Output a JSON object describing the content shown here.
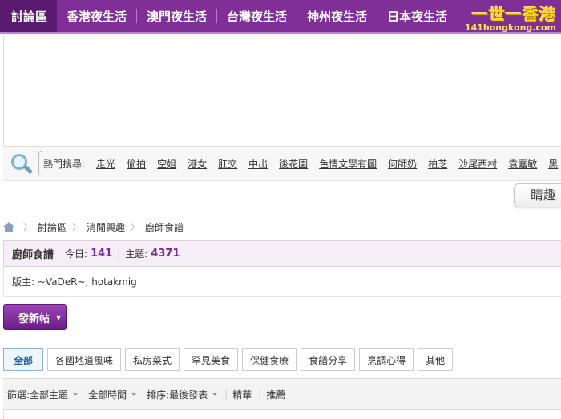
{
  "nav": {
    "items": [
      "討論區",
      "香港夜生活",
      "澳門夜生活",
      "台灣夜生活",
      "神州夜生活",
      "日本夜生活"
    ],
    "logo_main": "一世一香港",
    "logo_sub": "141hongkong.com"
  },
  "hot_search": {
    "label": "熱門搜尋:",
    "links": [
      "走光",
      "偷拍",
      "空姐",
      "港女",
      "肛交",
      "中出",
      "後花園",
      "色情文學有圖",
      "何師奶",
      "柏芝",
      "沙尾西村",
      "袁嘉敏",
      "黑"
    ]
  },
  "interest_button": "睛趣",
  "breadcrumb": [
    "討論區",
    "消閒興趣",
    "廚師食譜"
  ],
  "forum": {
    "name": "廚師食譜",
    "today_label": "今日:",
    "today_value": "141",
    "topics_label": "主題:",
    "topics_value": "4371",
    "moderators": "版主: ~VaDeR~, hotakmig"
  },
  "new_post_button": "發新帖",
  "tabs": [
    "全部",
    "各國地道風味",
    "私房菜式",
    "罕見美食",
    "保健食療",
    "食譜分享",
    "烹調心得",
    "其他"
  ],
  "filterbar": {
    "filter_label": "篩選:",
    "topic_filter": "全部主題",
    "time_filter": "全部時間",
    "sort_label": "排序:",
    "sort_value": "最後發表",
    "digest": "精華",
    "recommend": "推薦"
  }
}
